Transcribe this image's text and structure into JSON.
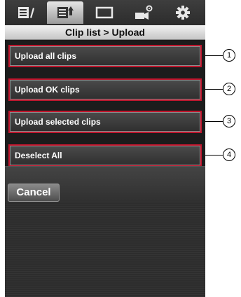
{
  "colors": {
    "highlight_border": "#c0162d",
    "screen_bg": "#2a2a2a",
    "title_bg": "#e0e0e0"
  },
  "tabs": [
    {
      "icon": "clip-edit-icon",
      "active": false
    },
    {
      "icon": "clip-upload-icon",
      "active": true
    },
    {
      "icon": "display-icon",
      "active": false
    },
    {
      "icon": "camera-settings-icon",
      "active": false
    },
    {
      "icon": "gear-icon",
      "active": false
    }
  ],
  "header": {
    "title": "Clip list > Upload"
  },
  "menu": {
    "items": [
      {
        "label": "Upload all clips",
        "callout": "1"
      },
      {
        "label": "Upload OK clips",
        "callout": "2"
      },
      {
        "label": "Upload selected clips",
        "callout": "3"
      },
      {
        "label": "Deselect All",
        "callout": "4"
      }
    ]
  },
  "footer": {
    "cancel_label": "Cancel"
  }
}
